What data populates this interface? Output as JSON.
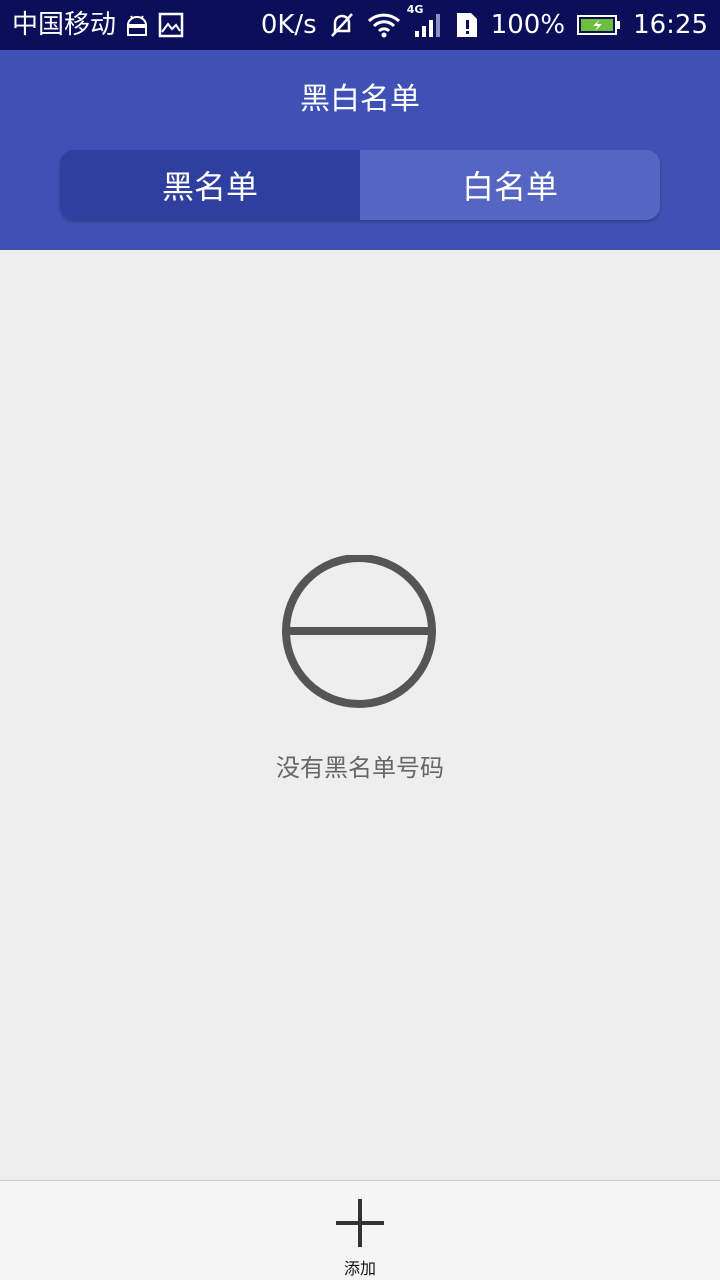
{
  "status_bar": {
    "carrier": "中国移动",
    "network_speed": "0K/s",
    "network_type": "4G",
    "battery": "100%",
    "time": "16:25",
    "icons": [
      "android-icon",
      "image-icon",
      "mute-icon",
      "wifi-icon",
      "signal-icon",
      "sim-alert-icon",
      "battery-icon"
    ]
  },
  "header": {
    "title": "黑白名单",
    "tabs": [
      {
        "label": "黑名单",
        "active": true
      },
      {
        "label": "白名单",
        "active": false
      }
    ]
  },
  "empty_state": {
    "icon": "no-entry-icon",
    "message": "没有黑名单号码"
  },
  "bottom_bar": {
    "add_label": "添加",
    "add_icon": "plus-icon"
  },
  "colors": {
    "status_bar": "#0b0f5a",
    "header": "#3f51b5",
    "tab_active": "#2f3fa0",
    "tab_inactive": "#5566c2",
    "background": "#eeeeee"
  }
}
